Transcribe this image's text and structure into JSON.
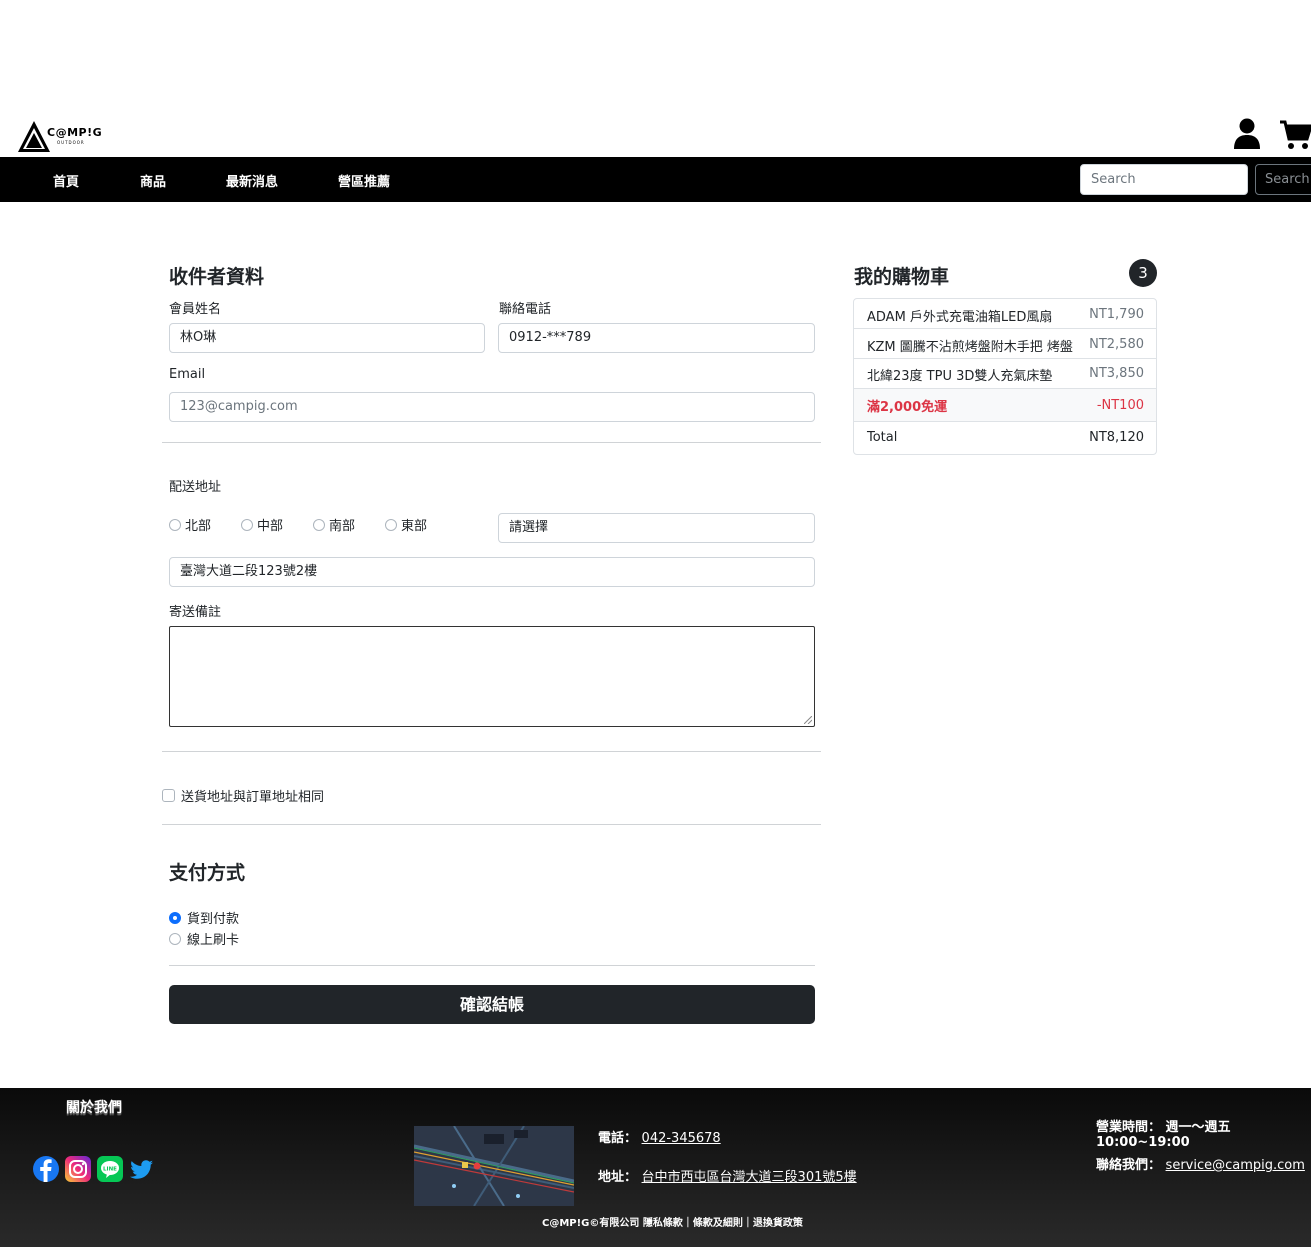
{
  "header": {
    "logo_text": "C@MP!G",
    "logo_sub": "OUTDOOR"
  },
  "nav": {
    "items": [
      "首頁",
      "商品",
      "最新消息",
      "營區推薦"
    ],
    "search_placeholder": "Search",
    "search_button": "Search"
  },
  "recipient": {
    "title": "收件者資料",
    "name_label": "會員姓名",
    "name_value": "林O琳",
    "phone_label": "聯絡電話",
    "phone_value": "0912-***789",
    "email_label": "Email",
    "email_placeholder": "123@campig.com"
  },
  "shipping": {
    "label": "配送地址",
    "regions": [
      "北部",
      "中部",
      "南部",
      "東部"
    ],
    "select_value": "請選擇",
    "address_value": "臺灣大道二段123號2樓",
    "note_label": "寄送備註",
    "same_address_label": "送貨地址與訂單地址相同"
  },
  "payment": {
    "title": "支付方式",
    "options": [
      "貨到付款",
      "線上刷卡"
    ],
    "selected": "貨到付款",
    "submit_label": "確認結帳"
  },
  "cart": {
    "title": "我的購物車",
    "count": "3",
    "items": [
      {
        "name": "ADAM 戶外式充電油箱LED風扇",
        "price": "NT1,790"
      },
      {
        "name": "KZM 圖騰不沾煎烤盤附木手把 烤盤",
        "price": "NT2,580"
      },
      {
        "name": "北緯23度 TPU 3D雙人充氣床墊",
        "price": "NT3,850"
      }
    ],
    "discount": {
      "name": "滿2,000免運",
      "price": "-NT100"
    },
    "total": {
      "name": "Total",
      "price": "NT8,120"
    }
  },
  "footer": {
    "about": "關於我們",
    "phone_label": "電話：",
    "phone_value": "042-345678",
    "address_label": "地址：",
    "address_value": "台中市西屯區台灣大道三段301號5樓",
    "hours_label": "營業時間：",
    "hours_value": "週一～週五 10:00~19:00",
    "contact_label": "聯絡我們：",
    "contact_value": "service@campig.com",
    "copyright": "C@MP!G©有限公司 隱私條款｜條款及細則｜退換貨政策",
    "social_icons": [
      "facebook-icon",
      "instagram-icon",
      "line-icon",
      "twitter-icon"
    ]
  },
  "colors": {
    "nav_bg": "#000000",
    "primary": "#0d6efd",
    "dark_button": "#212529",
    "discount_red": "#dc3545"
  }
}
